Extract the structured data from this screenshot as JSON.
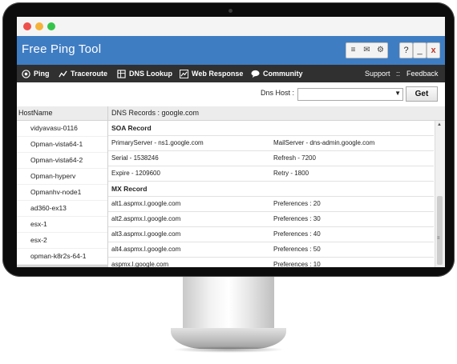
{
  "window": {
    "title": "Free Ping Tool"
  },
  "header_buttons": {
    "list_icon": "list-icon",
    "mail_icon": "mail-icon",
    "settings_icon": "gear-icon",
    "help": "?",
    "minimize": "_",
    "close": "x"
  },
  "toolbar": {
    "items": [
      {
        "label": "Ping",
        "icon": "ping-icon"
      },
      {
        "label": "Traceroute",
        "icon": "traceroute-icon"
      },
      {
        "label": "DNS Lookup",
        "icon": "dns-icon"
      },
      {
        "label": "Web Response",
        "icon": "web-response-icon"
      },
      {
        "label": "Community",
        "icon": "community-icon"
      }
    ],
    "support": "Support",
    "separator": "::",
    "feedback": "Feedback"
  },
  "dns": {
    "label": "Dns Host :",
    "value": "",
    "get_label": "Get"
  },
  "host_panel": {
    "header": "HostName",
    "hosts": [
      "vidyavasu-0116",
      "Opman-vista64-1",
      "Opman-vista64-2",
      "Opman-hyperv",
      "Opmanhv-node1",
      "ad360-ex13",
      "esx-1",
      "esx-2",
      "opman-k8r2s-64-1",
      ""
    ]
  },
  "records": {
    "header": "DNS Records  : google.com",
    "soa_title": "SOA Record",
    "soa_rows": [
      {
        "c1": "PrimaryServer - ns1.google.com",
        "c2": "MailServer - dns-admin.google.com"
      },
      {
        "c1": "Serial - 1538246",
        "c2": "Refresh - 7200"
      },
      {
        "c1": "Expire - 1209600",
        "c2": "Retry - 1800"
      }
    ],
    "mx_title": "MX Record",
    "mx_rows": [
      {
        "c1": "alt1.aspmx.l.google.com",
        "c2": "Preferences : 20"
      },
      {
        "c1": "alt2.aspmx.l.google.com",
        "c2": "Preferences : 30"
      },
      {
        "c1": "alt3.aspmx.l.google.com",
        "c2": "Preferences : 40"
      },
      {
        "c1": "alt4.aspmx.l.google.com",
        "c2": "Preferences : 50"
      },
      {
        "c1": "aspmx.l.google.com",
        "c2": "Preferences : 10"
      }
    ]
  },
  "colors": {
    "header_blue": "#3f7dc3",
    "toolbar_dark": "#303030"
  }
}
